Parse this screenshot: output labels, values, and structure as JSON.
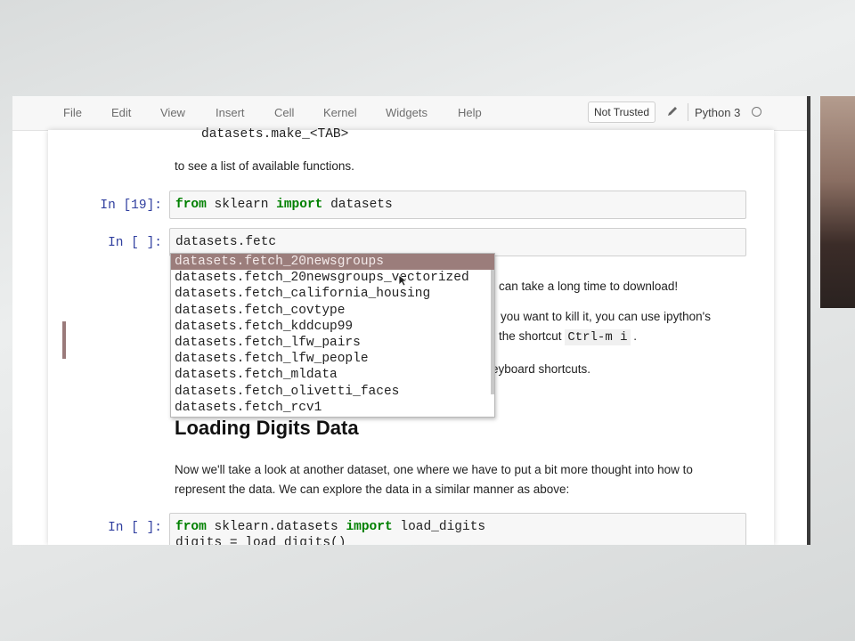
{
  "menu": {
    "items": [
      "File",
      "Edit",
      "View",
      "Insert",
      "Cell",
      "Kernel",
      "Widgets",
      "Help"
    ],
    "trust_label": "Not Trusted",
    "kernel_name": "Python 3"
  },
  "notebook": {
    "top_code": "datasets.make_<TAB>",
    "top_text": "to see a list of available functions.",
    "cell1": {
      "prompt": "In [19]:",
      "kw_from": "from",
      "module": "sklearn",
      "kw_import": "import",
      "name": "datasets"
    },
    "cell2": {
      "prompt": "In [ ]:",
      "code": "datasets.fetc"
    },
    "text_lines": {
      "line1": "can take a long time to download!",
      "line2": "you want to kill it, you can use ipython's",
      "line3_pre": "the shortcut",
      "line3_code": "Ctrl-m i",
      "line3_post": ".",
      "line4": "eyboard shortcuts."
    },
    "heading": "Loading Digits Data",
    "paragraph_line1": "Now we'll take a look at another dataset, one where we have to put a bit more thought into how to",
    "paragraph_line2": "represent the data. We can explore the data in a similar manner as above:",
    "cell3": {
      "prompt": "In [ ]:",
      "kw_from": "from",
      "module": "sklearn.datasets",
      "kw_import": "import",
      "name": "load_digits",
      "line2": "digits = load_digits()"
    }
  },
  "autocomplete": {
    "items": [
      "datasets.fetch_20newsgroups",
      "datasets.fetch_20newsgroups_vectorized",
      "datasets.fetch_california_housing",
      "datasets.fetch_covtype",
      "datasets.fetch_kddcup99",
      "datasets.fetch_lfw_pairs",
      "datasets.fetch_lfw_people",
      "datasets.fetch_mldata",
      "datasets.fetch_olivetti_faces",
      "datasets.fetch_rcv1"
    ],
    "selected_index": 0,
    "selected_color": "#9b7d7b"
  }
}
